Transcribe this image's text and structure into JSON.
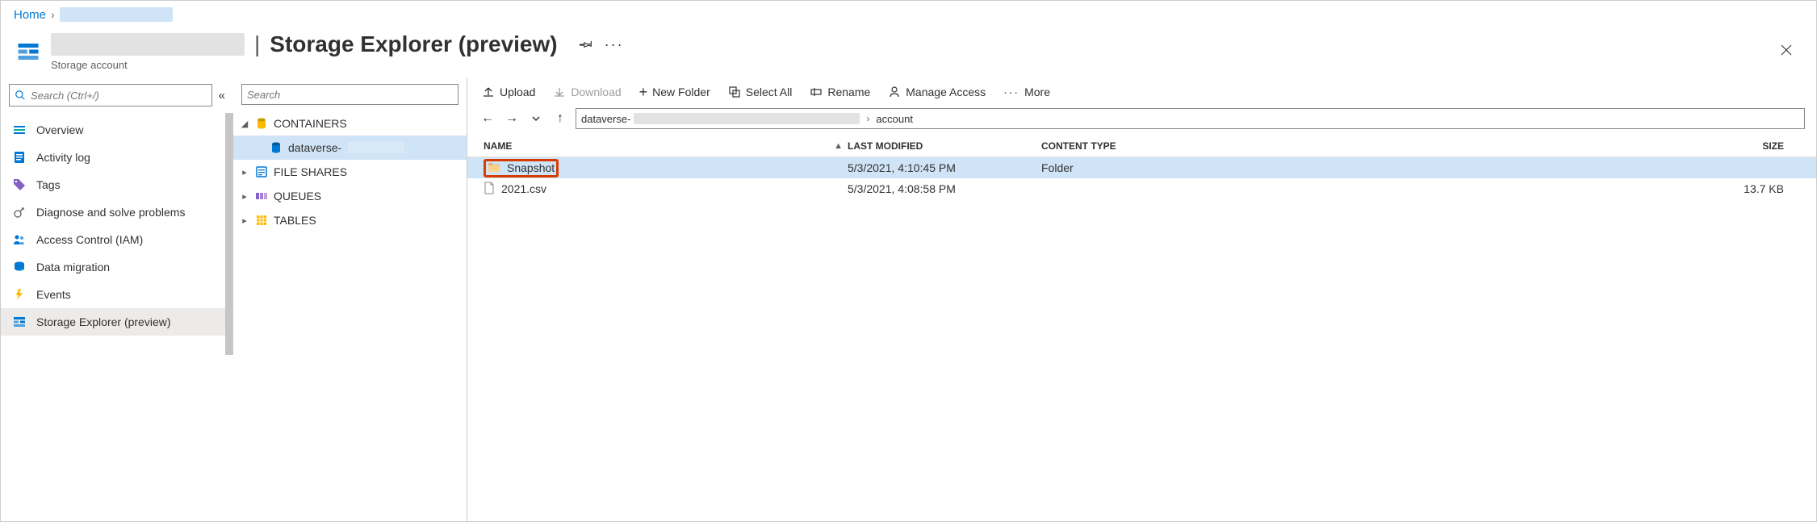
{
  "breadcrumb": {
    "home": "Home"
  },
  "header": {
    "title": "Storage Explorer (preview)",
    "subtitle": "Storage account"
  },
  "sidebar": {
    "search_placeholder": "Search (Ctrl+/)",
    "items": [
      {
        "label": "Overview"
      },
      {
        "label": "Activity log"
      },
      {
        "label": "Tags"
      },
      {
        "label": "Diagnose and solve problems"
      },
      {
        "label": "Access Control (IAM)"
      },
      {
        "label": "Data migration"
      },
      {
        "label": "Events"
      },
      {
        "label": "Storage Explorer (preview)"
      }
    ]
  },
  "tree": {
    "search_placeholder": "Search",
    "nodes": {
      "containers": "CONTAINERS",
      "dataverse": "dataverse-",
      "fileshares": "FILE SHARES",
      "queues": "QUEUES",
      "tables": "TABLES"
    }
  },
  "toolbar": {
    "upload": "Upload",
    "download": "Download",
    "new_folder": "New Folder",
    "select_all": "Select All",
    "rename": "Rename",
    "manage_access": "Manage Access",
    "more": "More"
  },
  "address": {
    "seg1": "dataverse-",
    "seg2": "account"
  },
  "columns": {
    "name": "NAME",
    "modified": "LAST MODIFIED",
    "type": "CONTENT TYPE",
    "size": "SIZE"
  },
  "rows": [
    {
      "name": "Snapshot",
      "modified": "5/3/2021, 4:10:45 PM",
      "type": "Folder",
      "size": "",
      "kind": "folder",
      "selected": true
    },
    {
      "name": "2021.csv",
      "modified": "5/3/2021, 4:08:58 PM",
      "type": "",
      "size": "13.7 KB",
      "kind": "file",
      "selected": false
    }
  ]
}
